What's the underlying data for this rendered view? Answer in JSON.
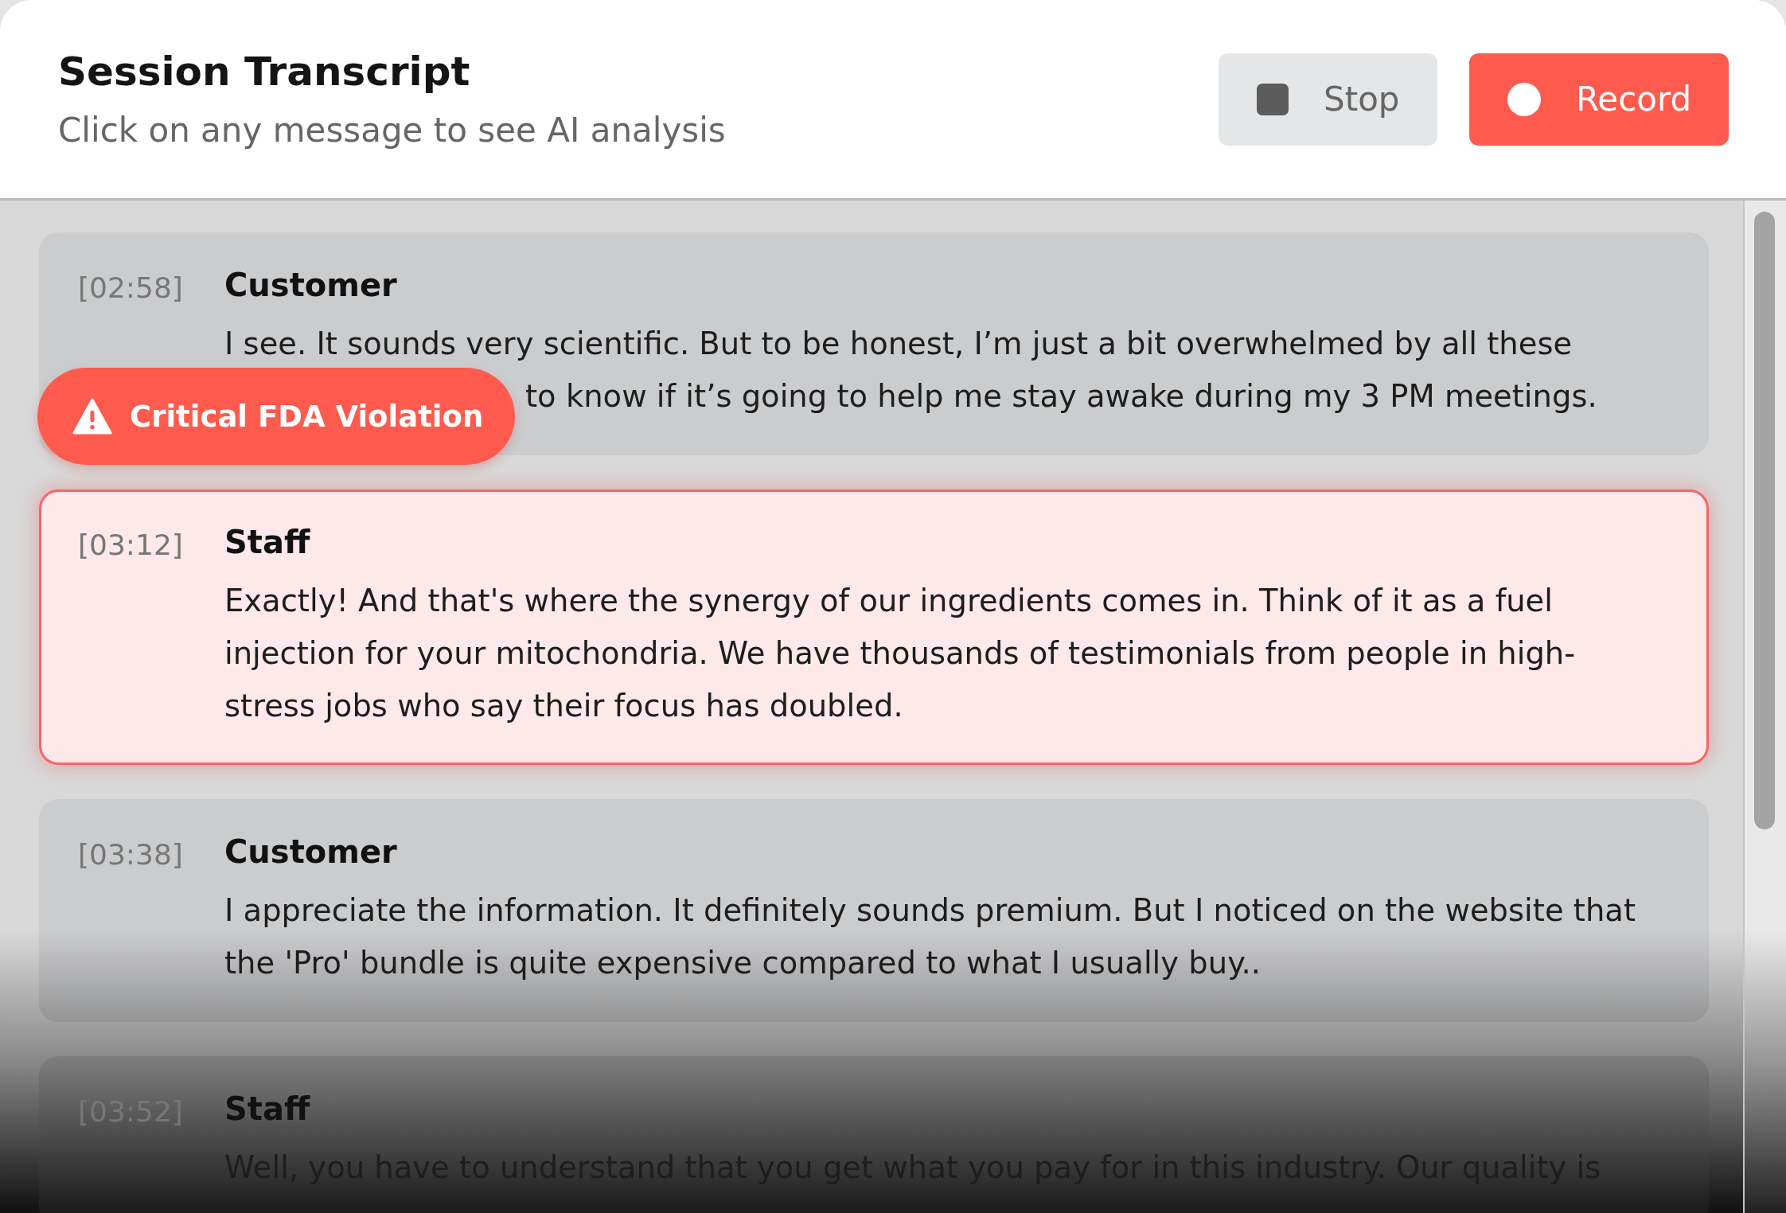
{
  "header": {
    "title": "Session Transcript",
    "subtitle": "Click on any message to see AI analysis"
  },
  "buttons": [
    {
      "kind": "stop",
      "label": "Stop"
    },
    {
      "kind": "record",
      "label": "Record"
    }
  ],
  "messages": [
    {
      "time": "[02:58]",
      "speaker": "Customer",
      "lines": [
        "I see. It sounds very scientific. But to be honest, I’m just a bit overwhelmed by all these",
        "to know if it’s going to help me stay awake during my 3 PM meetings."
      ],
      "selected": false
    },
    {
      "time": "[03:12]",
      "speaker": "Staff",
      "lines": [
        "Exactly! And that's where the synergy of our ingredients comes in. Think of it as a fuel",
        "injection for your mitochondria. We have thousands of testimonials from people in high-",
        "stress jobs who say their focus has doubled."
      ],
      "selected": true,
      "alert": "Critical FDA Violation"
    },
    {
      "time": "[03:38]",
      "speaker": "Customer",
      "lines": [
        "I appreciate the information. It definitely sounds premium. But I noticed on the website that",
        "the 'Pro' bundle is quite expensive compared to what I usually buy.."
      ],
      "selected": false
    },
    {
      "time": "[03:52]",
      "speaker": "Staff",
      "lines": [
        "Well, you have to understand that you get what you pay for in this industry. Our quality is"
      ],
      "selected": false
    }
  ]
}
